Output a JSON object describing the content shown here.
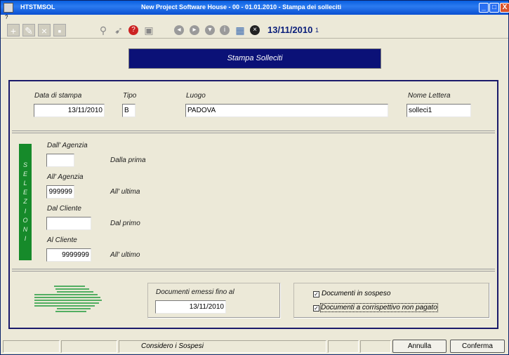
{
  "window": {
    "app_name": "HTSTMSOL",
    "title": "New Project Software House - 00 - 01.01.2010 - Stampa dei solleciti",
    "min_glyph": "_",
    "max_glyph": "□",
    "close_glyph": "X"
  },
  "menu": {
    "help": "?"
  },
  "toolbar": {
    "date": "13/11/2010",
    "counter": "1"
  },
  "banner": {
    "title": "Stampa Solleciti"
  },
  "header_fields": {
    "data_stampa_label": "Data di stampa",
    "data_stampa_value": "13/11/2010",
    "tipo_label": "Tipo",
    "tipo_value": "B",
    "luogo_label": "Luogo",
    "luogo_value": "PADOVA",
    "nome_lettera_label": "Nome Lettera",
    "nome_lettera_value": "solleci1"
  },
  "selezioni": {
    "letters": [
      "S",
      "E",
      "L",
      "E",
      "Z",
      "I",
      "O",
      "N",
      "I"
    ],
    "dall_agenzia_label": "Dall' Agenzia",
    "dall_agenzia_value": "",
    "dall_agenzia_hint": "Dalla prima",
    "all_agenzia_label": "All' Agenzia",
    "all_agenzia_value": "999999",
    "all_agenzia_hint": "All' ultima",
    "dal_cliente_label": "Dal Cliente",
    "dal_cliente_value": "",
    "dal_cliente_hint": "Dal primo",
    "al_cliente_label": "Al Cliente",
    "al_cliente_value": "9999999",
    "al_cliente_hint": "All' ultimo"
  },
  "documenti": {
    "emessi_label": "Documenti emessi fino al",
    "emessi_value": "13/11/2010",
    "sospeso_label": "Documenti in sospeso",
    "sospeso_checked": "✓",
    "corrispettivo_label": "Documenti a corrispettivo non pagato",
    "corrispettivo_checked": "✓"
  },
  "statusbar": {
    "text": "Considero i Sospesi",
    "annulla": "Annulla",
    "conferma": "Conferma"
  },
  "colors": {
    "banner": "#0b1177",
    "selezioni": "#168a2a",
    "arrow": "#1e9a3a"
  }
}
